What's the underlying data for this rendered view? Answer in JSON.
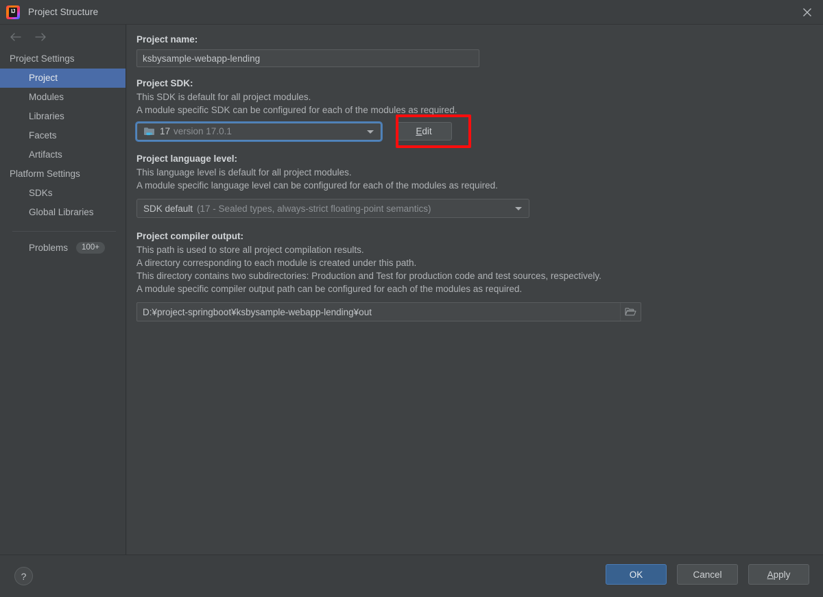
{
  "window": {
    "title": "Project Structure",
    "logo_icon": "intellij-idea-logo",
    "close_icon": "close-icon"
  },
  "sidebar": {
    "back_icon": "arrow-left-icon",
    "forward_icon": "arrow-right-icon",
    "groups": [
      {
        "label": "Project Settings",
        "items": [
          {
            "label": "Project",
            "selected": true
          },
          {
            "label": "Modules",
            "selected": false
          },
          {
            "label": "Libraries",
            "selected": false
          },
          {
            "label": "Facets",
            "selected": false
          },
          {
            "label": "Artifacts",
            "selected": false
          }
        ]
      },
      {
        "label": "Platform Settings",
        "items": [
          {
            "label": "SDKs",
            "selected": false
          },
          {
            "label": "Global Libraries",
            "selected": false
          }
        ]
      }
    ],
    "problems": {
      "label": "Problems",
      "count": "100+"
    }
  },
  "main": {
    "project_name": {
      "label": "Project name:",
      "value": "ksbysample-webapp-lending"
    },
    "project_sdk": {
      "label": "Project SDK:",
      "description_line1": "This SDK is default for all project modules.",
      "description_line2": "A module specific SDK can be configured for each of the modules as required.",
      "selected_name": "17",
      "selected_version": "version 17.0.1",
      "sdk_icon": "java-sdk-folder-icon",
      "dropdown_icon": "chevron-down-icon",
      "edit_button": "Edit",
      "edit_button_mnemonic": "E"
    },
    "language_level": {
      "label": "Project language level:",
      "description_line1": "This language level is default for all project modules.",
      "description_line2": "A module specific language level can be configured for each of the modules as required.",
      "selected_name": "SDK default",
      "selected_detail": "(17 - Sealed types, always-strict floating-point semantics)",
      "dropdown_icon": "chevron-down-icon"
    },
    "compiler_output": {
      "label": "Project compiler output:",
      "description_line1": "This path is used to store all project compilation results.",
      "description_line2": "A directory corresponding to each module is created under this path.",
      "description_line3": "This directory contains two subdirectories: Production and Test for production code and test sources, respectively.",
      "description_line4": "A module specific compiler output path can be configured for each of the modules as required.",
      "path": "D:¥project-springboot¥ksbysample-webapp-lending¥out",
      "browse_icon": "folder-open-icon"
    }
  },
  "footer": {
    "help_label": "?",
    "help_icon": "help-icon",
    "ok_label": "OK",
    "cancel_label": "Cancel",
    "apply_label": "Apply",
    "apply_mnemonic": "A"
  },
  "annotation": {
    "highlight_color": "#fd0d0d",
    "target": "edit-button"
  },
  "colors": {
    "dialog_bg": "#3c3f41",
    "main_bg": "#3f4244",
    "selection_blue": "#4a6ca8",
    "primary_button": "#38618f",
    "focus_ring": "#4a7cb2"
  }
}
